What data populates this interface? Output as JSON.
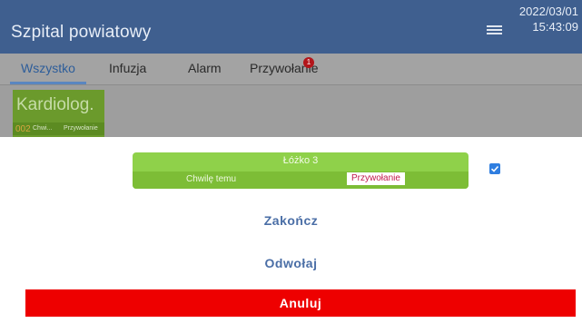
{
  "header": {
    "title": "Szpital powiatowy",
    "date": "2022/03/01",
    "time": "15:43:09",
    "menu_icon": "hamburger-menu-icon"
  },
  "tabs": [
    {
      "label": "Wszystko",
      "active": true
    },
    {
      "label": "Infuzja",
      "active": false
    },
    {
      "label": "Alarm",
      "active": false
    },
    {
      "label": "Przywołanie",
      "active": false,
      "badge": "1"
    }
  ],
  "room_card": {
    "name": "Kardiolog.",
    "number": "002",
    "subtitle": "Chwi...",
    "tag": "Przywołanie"
  },
  "dialog": {
    "bed": {
      "title": "Łóżko 3",
      "time": "Chwilę temu",
      "status": "Przywołanie"
    },
    "checkbox_checked": true,
    "finish_label": "Zakończ",
    "revoke_label": "Odwołaj",
    "cancel_label": "Anuluj"
  },
  "colors": {
    "header_bg": "#3f5f8f",
    "bed_card": "#8fd14a",
    "cancel_button": "#ee0000",
    "action_text": "#4a6ea6",
    "status_text": "#c2184b"
  }
}
